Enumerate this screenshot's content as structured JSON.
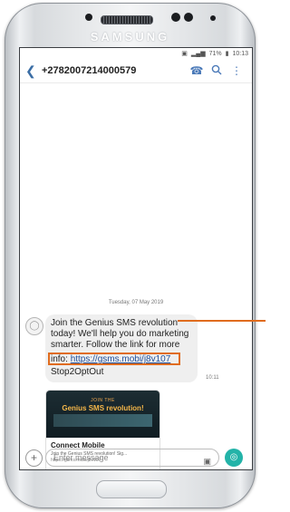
{
  "device": {
    "brand": "SAMSUNG"
  },
  "status": {
    "battery": "71%",
    "time": "10:13"
  },
  "header": {
    "contact": "+2782007214000579"
  },
  "thread": {
    "date_label": "Tuesday, 07 May 2019",
    "message_lines": {
      "l1": "Join the Genius SMS revolution",
      "l2": "today! We'll help you do marketing",
      "l3": "smarter. Follow the link for more",
      "l4_prefix": "info: ",
      "l4_link": "https://gsms.mobi/j8v107",
      "l5": "Stop2OptOut"
    },
    "time": "10:11"
  },
  "preview": {
    "image_sub": "JOIN THE",
    "image_title": "Genius SMS revolution!",
    "title": "Connect Mobile",
    "desc": "Join the Genius SMS revolution! Sig...",
    "url": "https://gsms.mobi/j8v107"
  },
  "compose": {
    "placeholder": "Enter message"
  },
  "colors": {
    "accent": "#e06c1e",
    "send": "#23b3a8",
    "link": "#1f4f9c"
  }
}
